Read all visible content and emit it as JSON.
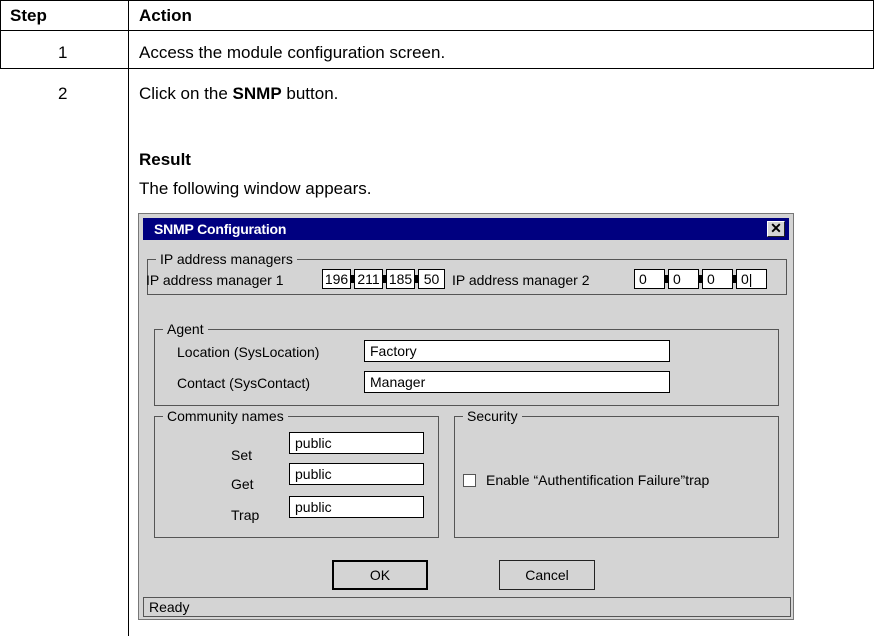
{
  "table": {
    "header": {
      "step": "Step",
      "action": "Action"
    },
    "rows": [
      {
        "step": "1",
        "action": "Access the module configuration screen."
      },
      {
        "step": "2",
        "action_pre": "Click on the ",
        "action_bold": "SNMP",
        "action_post": " button.",
        "result_heading": "Result",
        "result_text": "The following window appears."
      }
    ]
  },
  "window": {
    "title": "SNMP Configuration",
    "close_symbol": "✕",
    "ip_group": {
      "label": "IP address managers",
      "manager1_label": "IP address manager 1",
      "manager1": [
        "196",
        "211",
        "185",
        "50"
      ],
      "manager2_label": "IP address manager 2",
      "manager2": [
        "0",
        "0",
        "0",
        "0|"
      ]
    },
    "agent_group": {
      "label": "Agent",
      "location_label": "Location (SysLocation)",
      "location_value": "Factory",
      "contact_label": "Contact (SysContact)",
      "contact_value": "Manager"
    },
    "community_group": {
      "label": "Community names",
      "set_label": "Set",
      "set_value": "public",
      "get_label": "Get",
      "get_value": "public",
      "trap_label": "Trap",
      "trap_value": "public"
    },
    "security_group": {
      "label": "Security",
      "checkbox_label": "Enable “Authentification Failure”trap",
      "checkbox_checked": false
    },
    "ok_label": "OK",
    "cancel_label": "Cancel",
    "status": "Ready"
  },
  "colors": {
    "titlebar": "#000080",
    "dialog_bg": "#d4d4d4"
  }
}
